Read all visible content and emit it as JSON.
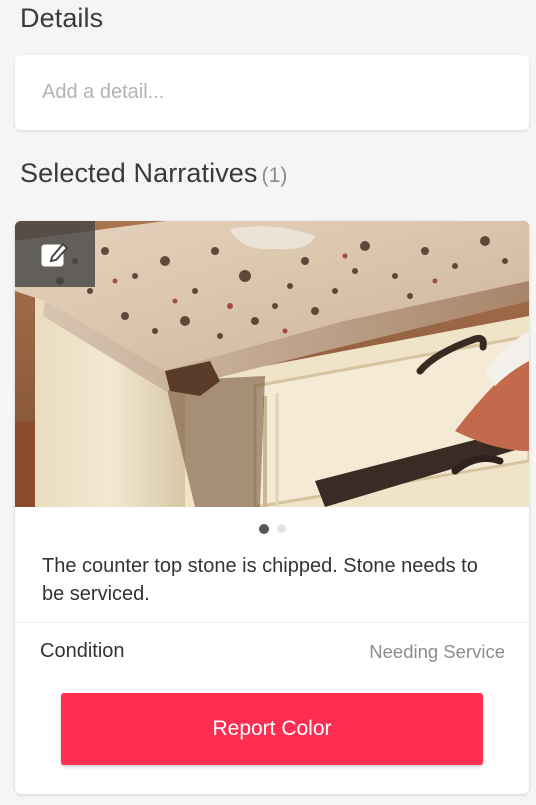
{
  "details": {
    "title": "Details",
    "input_placeholder": "Add a detail...",
    "input_value": ""
  },
  "narratives": {
    "title": "Selected Narratives",
    "count": "(1)"
  },
  "card": {
    "image_icon": "edit-icon",
    "pager": {
      "total": 2,
      "current": 1
    },
    "text": "The counter top stone is chipped. Stone needs to be serviced.",
    "condition_label": "Condition",
    "condition_value": "Needing Service",
    "button_label": "Report Color"
  },
  "colors": {
    "accent": "#ff2d4f",
    "background": "#f5f5f5"
  }
}
